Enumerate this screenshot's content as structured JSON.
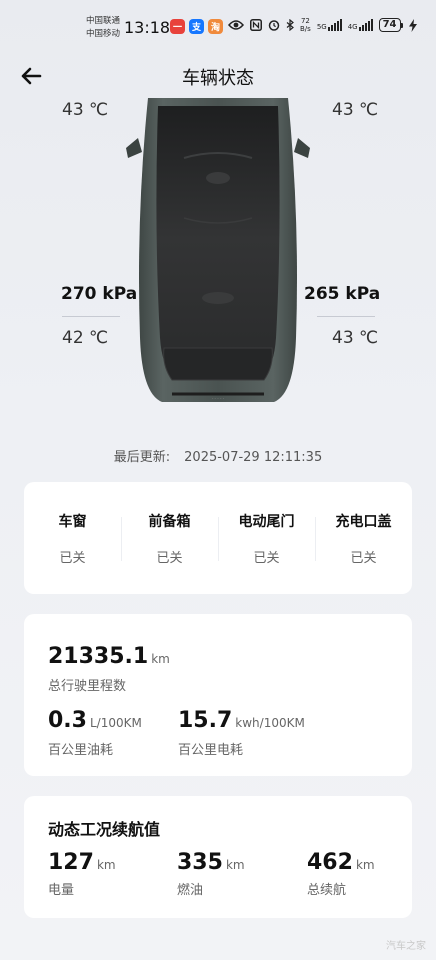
{
  "status_bar": {
    "carrier_1": "中国联通",
    "carrier_2": "中国移动",
    "time": "13:18",
    "net_speed_value": "72",
    "net_speed_unit": "B/s",
    "signal_1_label": "5G",
    "signal_2_label": "4G",
    "battery": "74",
    "apps": [
      {
        "icon": "red-app-icon",
        "color": "#e8423b",
        "glyph": "一"
      },
      {
        "icon": "alipay-icon",
        "color": "#1677ff",
        "glyph": "支"
      },
      {
        "icon": "orange-app-icon",
        "color": "#f08a3c",
        "glyph": "淘"
      }
    ]
  },
  "header": {
    "title": "车辆状态",
    "back_icon": "arrow-left-icon"
  },
  "tires": {
    "front_left_temp": "43 ℃",
    "front_right_temp": "43 ℃",
    "rear_left_pressure": "270 kPa",
    "rear_left_temp": "42 ℃",
    "rear_right_pressure": "265 kPa",
    "rear_right_temp": "43 ℃"
  },
  "car": {
    "body_color": "#4c5654",
    "roof_color": "#2d2d2e"
  },
  "last_updated": {
    "label": "最后更新:",
    "value": "2025-07-29 12:11:35"
  },
  "closures": [
    {
      "name": "车窗",
      "state": "已关"
    },
    {
      "name": "前备箱",
      "state": "已关"
    },
    {
      "name": "电动尾门",
      "state": "已关"
    },
    {
      "name": "充电口盖",
      "state": "已关"
    }
  ],
  "mileage": {
    "odometer_value": "21335.1",
    "odometer_unit": "km",
    "odometer_label": "总行驶里程数",
    "fuel_value": "0.3",
    "fuel_unit": "L/100KM",
    "fuel_label": "百公里油耗",
    "elec_value": "15.7",
    "elec_unit": "kwh/100KM",
    "elec_label": "百公里电耗"
  },
  "range": {
    "title": "动态工况续航值",
    "items": [
      {
        "value": "127",
        "unit": "km",
        "label": "电量"
      },
      {
        "value": "335",
        "unit": "km",
        "label": "燃油"
      },
      {
        "value": "462",
        "unit": "km",
        "label": "总续航"
      }
    ]
  },
  "watermark": "汽车之家"
}
